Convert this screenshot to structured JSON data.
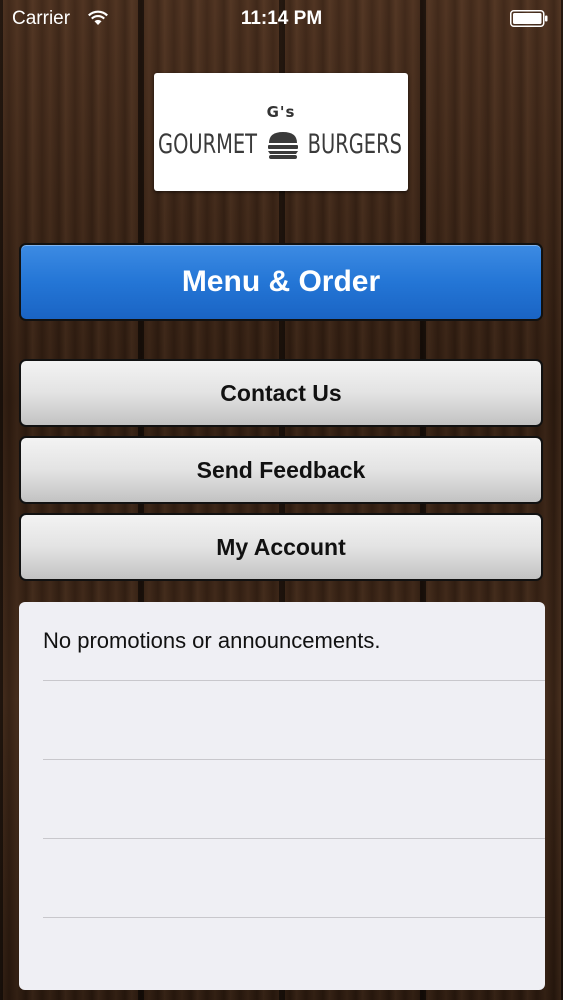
{
  "status_bar": {
    "carrier": "Carrier",
    "time": "11:14 PM",
    "wifi_icon": "wifi-icon",
    "battery_icon": "battery-icon"
  },
  "logo": {
    "small_text": "G's",
    "word_left": "GOURMET",
    "word_right": "BURGERS",
    "icon": "burger-icon"
  },
  "buttons": {
    "menu_order": "Menu & Order",
    "contact": "Contact Us",
    "feedback": "Send Feedback",
    "account": "My Account"
  },
  "announcements": {
    "rows": [
      "No promotions or announcements.",
      "",
      "",
      "",
      ""
    ]
  },
  "colors": {
    "primary_button": "#2476d6",
    "secondary_button": "#e3e3e3",
    "panel_background": "#efeff4"
  }
}
